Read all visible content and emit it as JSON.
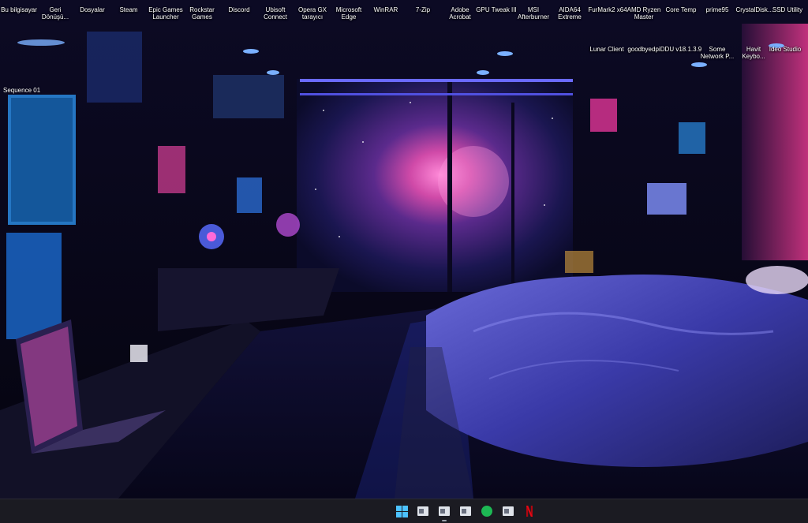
{
  "desktop": {
    "top_row": [
      "Bu bilgisayar",
      "Geri\nDönüşü...",
      "Dosyalar",
      "Steam",
      "Epic Games\nLauncher",
      "Rockstar\nGames",
      "Discord",
      "Ubisoft\nConnect",
      "Opera GX\ntarayıcı",
      "Microsoft\nEdge",
      "WinRAR",
      "7-Zip",
      "Adobe\nAcrobat",
      "GPU Tweak III",
      "MSI\nAfterburner",
      "AIDA64\nExtreme",
      "FurMark2 x64",
      "AMD Ryzen\nMaster",
      "Core Temp",
      "prime95",
      "CrystalDisk...",
      "SSD Utility"
    ],
    "second_row": [
      "Lunar Client",
      "goodbyedpi",
      "DDU v18.1.3.9",
      "Some\nNetwork P...",
      "Havit\nKeybo...",
      "Ideo Studio"
    ],
    "sequence_label": "Sequence 01"
  },
  "taskbar": {
    "apps": [
      "start-icon",
      "file-explorer-icon",
      "app-window-icon",
      "app-window-icon",
      "spotify-icon",
      "app-window-icon",
      "netflix-icon"
    ]
  },
  "colors": {
    "taskbar_bg": "#1b1b22",
    "start_blue": "#4cc2ff",
    "spotify_green": "#1db954",
    "netflix_red": "#e50914",
    "neon_blue": "#3d5cff",
    "neon_pink": "#ff3ca8"
  }
}
